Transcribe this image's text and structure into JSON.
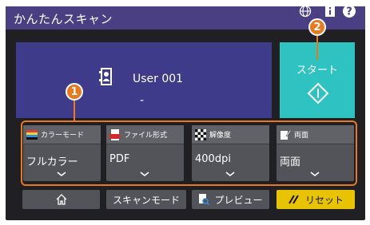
{
  "header": {
    "title": "かんたんスキャン",
    "globe_icon": "globe-icon",
    "info_icon": "info-icon",
    "help_icon": "help-icon",
    "help_label": "?"
  },
  "user": {
    "name": "User 001",
    "count": "-",
    "icon": "user-icon"
  },
  "start": {
    "label": "スタート",
    "icon": "start-diamond-icon"
  },
  "settings": [
    {
      "label": "カラーモード",
      "value": "フルカラー",
      "icon": "color-mode-icon"
    },
    {
      "label": "ファイル形式",
      "value": "PDF",
      "icon": "pdf-file-icon"
    },
    {
      "label": "解像度",
      "value": "400dpi",
      "icon": "resolution-icon"
    },
    {
      "label": "両面",
      "value": "両面",
      "icon": "duplex-icon"
    }
  ],
  "bottom": {
    "home_icon": "home-icon",
    "scan_mode": "スキャンモード",
    "preview": "プレビュー",
    "reset": "リセット"
  },
  "callouts": [
    "1",
    "2"
  ],
  "colors": {
    "title_bar": "#4b3f84",
    "user_panel": "#3e3b8a",
    "start_button": "#2ec2c0",
    "callout": "#e87a1d",
    "reset_button": "#e8c300",
    "background": "#1f1f24"
  }
}
